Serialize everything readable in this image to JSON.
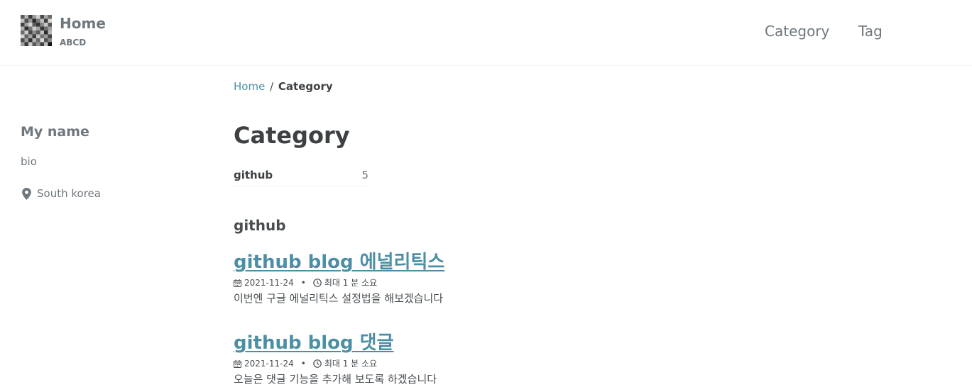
{
  "masthead": {
    "title": "Home",
    "subtitle": "ABCD",
    "nav": [
      {
        "label": "Category"
      },
      {
        "label": "Tag"
      }
    ]
  },
  "sidebar": {
    "name": "My name",
    "bio": "bio",
    "location": "South korea",
    "location_icon": "map-marker-icon"
  },
  "breadcrumb": {
    "home": "Home",
    "separator": "/",
    "current": "Category"
  },
  "page": {
    "title": "Category"
  },
  "taxonomy": [
    {
      "name": "github",
      "count": "5"
    }
  ],
  "sections": [
    {
      "title": "github",
      "posts": [
        {
          "title": "github blog 에널리틱스",
          "date": "2021-11-24",
          "read_time": "최대 1 분 소요",
          "excerpt": "이번엔 구글 에널리틱스 설정법을 해보겠습니다"
        },
        {
          "title": "github blog 댓글",
          "date": "2021-11-24",
          "read_time": "최대 1 분 소요",
          "excerpt": "오늘은 댓글 기능을 추가해 보도록 하겠습니다"
        }
      ]
    }
  ],
  "colors": {
    "link": "#4c8fa4",
    "text": "#494e52",
    "muted": "#6f777d"
  }
}
